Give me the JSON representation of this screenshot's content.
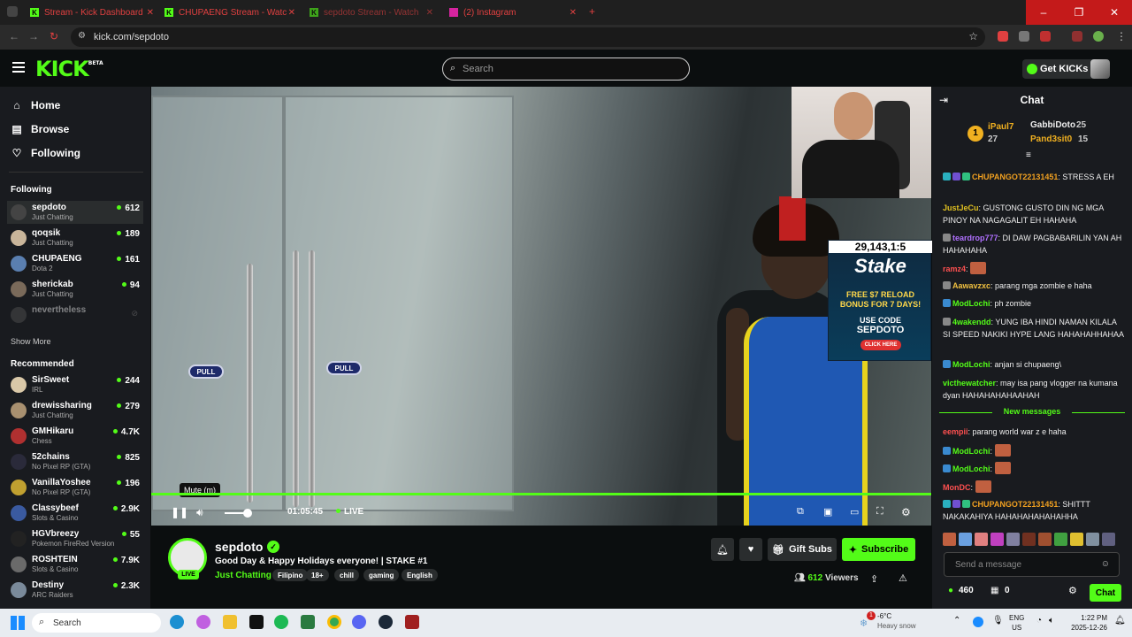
{
  "browser": {
    "tabs": [
      {
        "title": "Stream - Kick Dashboard"
      },
      {
        "title": "CHUPAENG Stream - Watc"
      },
      {
        "title": "sepdoto Stream - Watch"
      },
      {
        "title": "(2) Instagram"
      }
    ],
    "url": "kick.com/sepdoto"
  },
  "header": {
    "logo": "KICK",
    "logo_badge": "BETA",
    "search_placeholder": "Search",
    "get_kicks": "Get KICKs"
  },
  "sidebar": {
    "nav": [
      {
        "label": "Home",
        "icon": "home-icon"
      },
      {
        "label": "Browse",
        "icon": "browse-icon"
      },
      {
        "label": "Following",
        "icon": "heart-icon"
      }
    ],
    "following_heading": "Following",
    "following": [
      {
        "name": "sepdoto",
        "category": "Just Chatting",
        "viewers": "612",
        "color": "#444"
      },
      {
        "name": "qoqsik",
        "category": "Just Chatting",
        "viewers": "189",
        "color": "#c9b59a"
      },
      {
        "name": "CHUPAENG",
        "category": "Dota 2",
        "viewers": "161",
        "color": "#5a7fb0"
      },
      {
        "name": "sherickab",
        "category": "Just Chatting",
        "viewers": "94",
        "color": "#7a6a5a"
      },
      {
        "name": "nevertheless",
        "category": "",
        "viewers": "",
        "color": "#555"
      }
    ],
    "show_more": "Show More",
    "recommended_heading": "Recommended",
    "recommended": [
      {
        "name": "SirSweet",
        "category": "IRL",
        "viewers": "244",
        "color": "#d9c8a8"
      },
      {
        "name": "drewissharing",
        "category": "Just Chatting",
        "viewers": "279",
        "color": "#a89070"
      },
      {
        "name": "GMHikaru",
        "category": "Chess",
        "viewers": "4.7K",
        "color": "#b03030"
      },
      {
        "name": "52chains",
        "category": "No Pixel RP (GTA)",
        "viewers": "825",
        "color": "#2a2a3a"
      },
      {
        "name": "VanillaYoshee",
        "category": "No Pixel RP (GTA)",
        "viewers": "196",
        "color": "#c0a030"
      },
      {
        "name": "Classybeef",
        "category": "Slots & Casino",
        "viewers": "2.9K",
        "color": "#3a5aa0"
      },
      {
        "name": "HGVbreezy",
        "category": "Pokemon FireRed Version",
        "viewers": "55",
        "color": "#222"
      },
      {
        "name": "ROSHTEIN",
        "category": "Slots & Casino",
        "viewers": "7.9K",
        "color": "#6a6a6a"
      },
      {
        "name": "Destiny",
        "category": "ARC Raiders",
        "viewers": "2.3K",
        "color": "#7a8a9a"
      }
    ]
  },
  "video": {
    "pull_label": "PULL",
    "ad": {
      "counter": "29,143,1:5",
      "brand": "Stake",
      "line1": "FREE $7 RELOAD",
      "line2": "BONUS FOR 7 DAYS!",
      "line3": "USE CODE",
      "code": "SEPDOTO",
      "cta": "CLICK HERE"
    },
    "tooltip": "Mute (m)",
    "timestamp": "01:05:45",
    "live_label": "LIVE",
    "progress_fraction": 1.0,
    "volume_fraction": 0.85
  },
  "channel": {
    "name": "sepdoto",
    "live_badge": "LIVE",
    "title": "Good Day & Happy Holidays everyone! | STAKE #1",
    "category": "Just Chatting",
    "tags": [
      "Filipino",
      "18+",
      "chill",
      "gaming",
      "English"
    ],
    "gift_subs": "Gift Subs",
    "subscribe": "Subscribe",
    "viewers": "612",
    "viewers_label": "Viewers"
  },
  "chat": {
    "title": "Chat",
    "gifters": [
      {
        "name": "iPaul7",
        "count": "27"
      },
      {
        "name": "GabbiDoto",
        "count": "25"
      },
      {
        "name": "Pand3sit0",
        "count": "15"
      }
    ],
    "gifter_rank": "1",
    "messages": [
      {
        "user": "CHUPANGOT22131451",
        "color": "#f0a020",
        "text": "STRESS A EH"
      },
      {
        "user": "JustJeCu",
        "color": "#e0c020",
        "text": "GUSTONG GUSTO DIN NG MGA PINOY NA NAGAGALIT EH HAHAHA"
      },
      {
        "user": "teardrop777",
        "color": "#b070ff",
        "text": "DI DAW PAGBABARILIN YAN AH HAHAHAHA"
      },
      {
        "user": "ramz4",
        "color": "#ff5050",
        "text": ""
      },
      {
        "user": "Aawavzxc",
        "color": "#f0c040",
        "text": "parang mga zombie e haha"
      },
      {
        "user": "ModLochi",
        "color": "#53fc18",
        "text": "ph zombie"
      },
      {
        "user": "4wakendd",
        "color": "#53fc18",
        "text": "YUNG IBA HINDI NAMAN KILALA SI SPEED NAKIKI HYPE LANG HAHAHAHHAHAA"
      },
      {
        "user": "ModLochi",
        "color": "#53fc18",
        "text": "anjan si chupaeng\\"
      },
      {
        "user": "victhewatcher",
        "color": "#53fc18",
        "text": "may isa pang vlogger na kumana dyan HAHAHAHAHAAHAH"
      }
    ],
    "new_messages_label": "New messages",
    "new_messages": [
      {
        "user": "eempii",
        "color": "#ff5050",
        "text": "parang world war z e haha"
      },
      {
        "user": "ModLochi",
        "color": "#53fc18",
        "text": ""
      },
      {
        "user": "ModLochi",
        "color": "#53fc18",
        "text": ""
      },
      {
        "user": "MonDC",
        "color": "#ff5050",
        "text": ""
      },
      {
        "user": "CHUPANGOT22131451",
        "color": "#f0a020",
        "text": "SHITTT NAKAKAHIYA HAHAHAHAHAHAHHA"
      }
    ],
    "input_placeholder": "Send a message",
    "kicks_balance": "460",
    "points": "0",
    "send_label": "Chat"
  },
  "taskbar": {
    "search_placeholder": "Search",
    "weather_temp": "-6°C",
    "weather_desc": "Heavy snow",
    "weather_badge": "1",
    "lang1": "ENG",
    "lang2": "US",
    "time": "1:22 PM",
    "date": "2025-12-26"
  }
}
